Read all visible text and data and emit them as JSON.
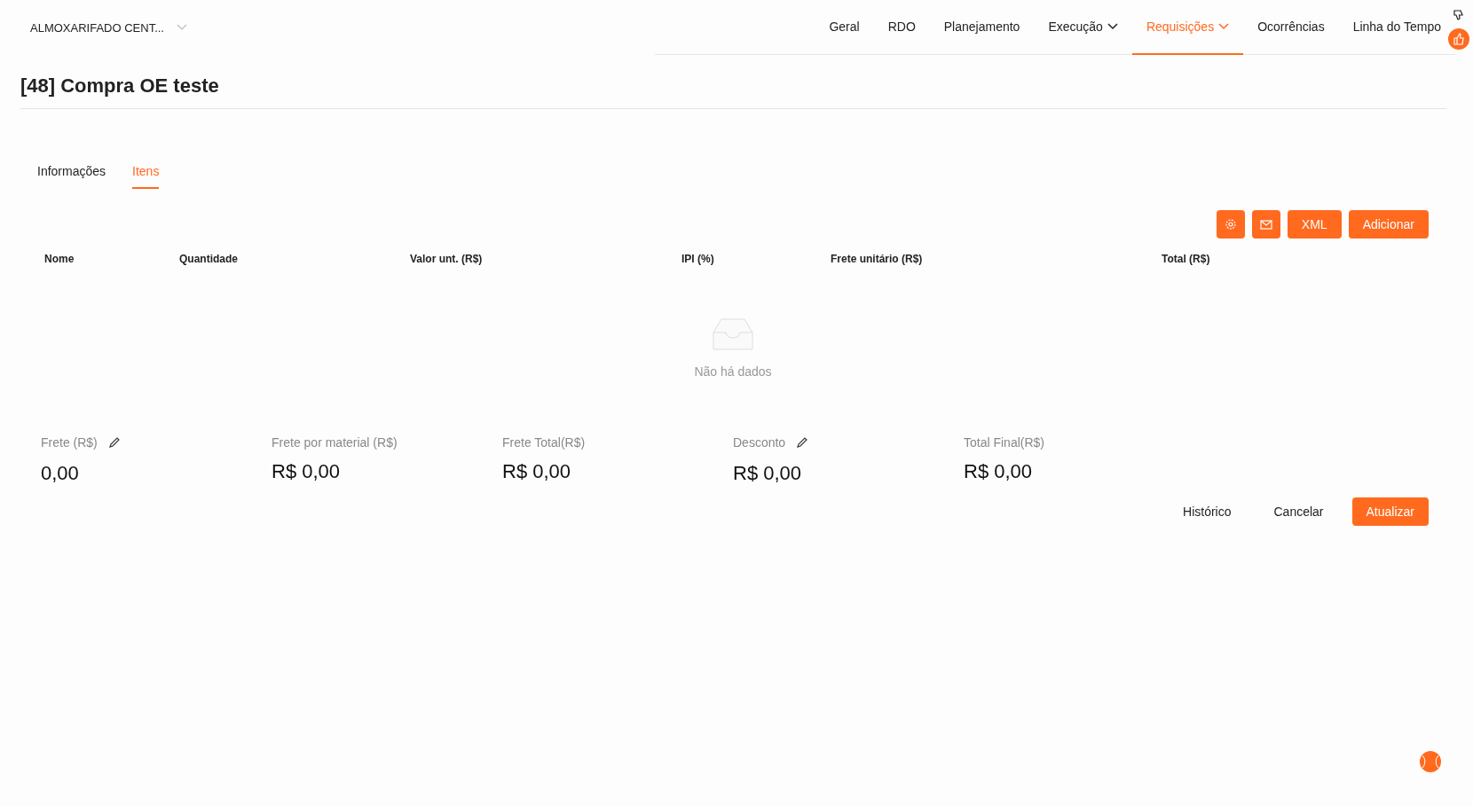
{
  "project_selector": {
    "value": "ALMOXARIFADO CENT..."
  },
  "nav": [
    {
      "label": "Geral",
      "selected": false,
      "dropdown": false
    },
    {
      "label": "RDO",
      "selected": false,
      "dropdown": false
    },
    {
      "label": "Planejamento",
      "selected": false,
      "dropdown": false
    },
    {
      "label": "Execução",
      "selected": false,
      "dropdown": true
    },
    {
      "label": "Requisições",
      "selected": true,
      "dropdown": true
    },
    {
      "label": "Ocorrências",
      "selected": false,
      "dropdown": false
    },
    {
      "label": "Linha do Tempo",
      "selected": false,
      "dropdown": false
    }
  ],
  "title": "[48] Compra OE teste",
  "tabs": [
    {
      "label": "Informações",
      "selected": false
    },
    {
      "label": "Itens",
      "selected": true
    }
  ],
  "toolbar": [
    {
      "kind": "settings"
    },
    {
      "kind": "mail"
    },
    {
      "kind": "text",
      "label": "XML"
    },
    {
      "kind": "text",
      "label": "Adicionar"
    }
  ],
  "table": {
    "columns": [
      "Nome",
      "Quantidade",
      "Valor unt. (R$)",
      "IPI (%)",
      "Frete unitário (R$)",
      "Total (R$)"
    ],
    "empty_text": "Não há dados"
  },
  "summary": [
    {
      "label": "Frete (R$)",
      "value": "0,00",
      "editable": true
    },
    {
      "label": "Frete por material (R$)",
      "value": "R$ 0,00",
      "editable": false
    },
    {
      "label": "Frete Total(R$)",
      "value": "R$ 0,00",
      "editable": false
    },
    {
      "label": "Desconto",
      "value": "R$ 0,00",
      "editable": true
    },
    {
      "label": "Total Final(R$)",
      "value": "R$ 0,00",
      "editable": false
    }
  ],
  "actions": [
    {
      "label": "Histórico",
      "primary": false
    },
    {
      "label": "Cancelar",
      "primary": false
    },
    {
      "label": "Atualizar",
      "primary": true
    }
  ]
}
